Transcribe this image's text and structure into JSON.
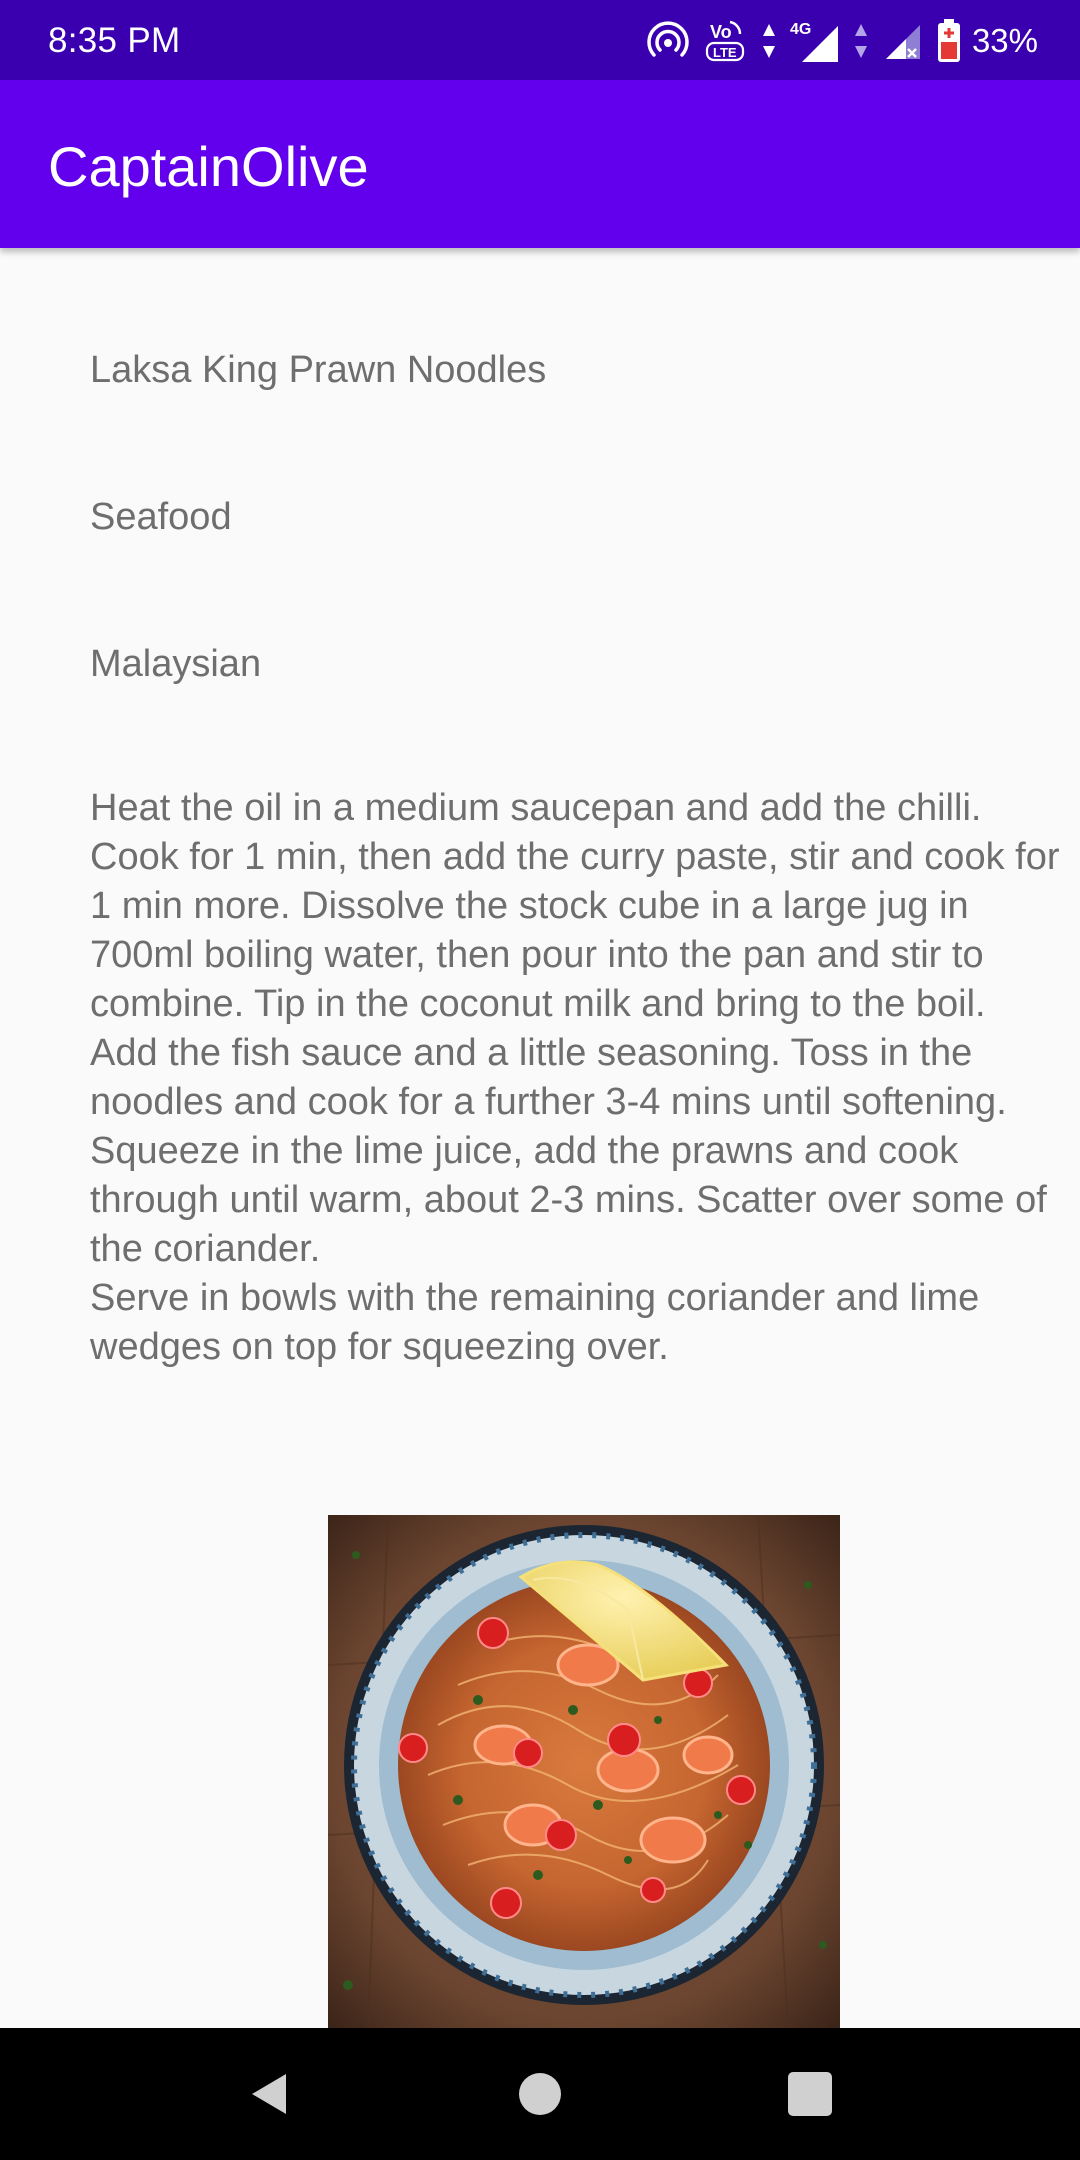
{
  "status_bar": {
    "time": "8:35 PM",
    "network": "4G",
    "volte": "Vo LTE",
    "battery_percent": "33%"
  },
  "app_bar": {
    "title": "CaptainOlive"
  },
  "meal": {
    "name": "Laksa King Prawn Noodles",
    "category": "Seafood",
    "area": "Malaysian",
    "instructions": "Heat the oil in a medium saucepan and add the chilli. Cook for 1 min, then add the curry paste, stir and cook for 1 min more. Dissolve the stock cube in a large jug in 700ml boiling water, then pour into the pan and stir to combine. Tip in the coconut milk and bring to the boil.\nAdd the fish sauce and a little seasoning. Toss in the noodles and cook for a further 3-4 mins until softening. Squeeze in the lime juice, add the prawns and cook through until warm, about 2-3 mins. Scatter over some of the coriander.\nServe in bowls with the remaining coriander and lime wedges on top for squeezing over."
  },
  "nav_bar": {
    "icons": [
      "back-icon",
      "home-icon",
      "recents-icon"
    ]
  },
  "colors": {
    "status_bar": "#3a00b0",
    "app_bar": "#6200ee",
    "background": "#fafafa",
    "text": "#6e6e6e"
  }
}
